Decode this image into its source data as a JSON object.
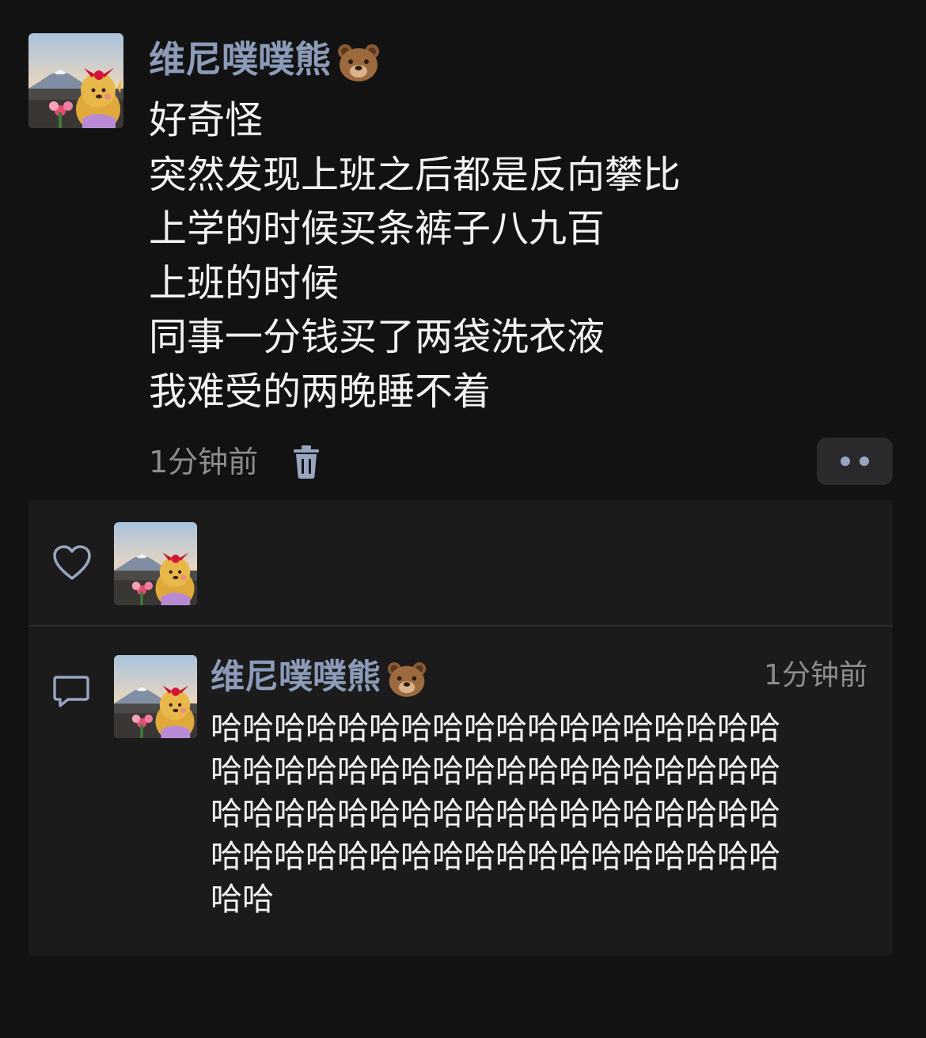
{
  "post": {
    "author": {
      "name": "维尼噗噗熊",
      "emoji": "bear-face-emoji",
      "avatar": "avatar-winnie-pooh-mount-fuji"
    },
    "lines": [
      "好奇怪",
      "突然发现上班之后都是反向攀比",
      "上学的时候买条裤子八九百",
      "上班的时候",
      "同事一分钱买了两袋洗衣液",
      "我难受的两晚睡不着"
    ],
    "time": "1分钟前",
    "delete_icon": "trash-icon",
    "more_icon": "more-dots-icon"
  },
  "likes": {
    "icon": "heart-icon",
    "avatars": [
      "avatar-winnie-pooh-mount-fuji"
    ]
  },
  "comments": {
    "icon": "comment-icon",
    "items": [
      {
        "author": "维尼噗噗熊",
        "emoji": "bear-face-emoji",
        "time": "1分钟前",
        "lines": [
          "哈哈哈哈哈哈哈哈哈哈哈哈哈哈哈哈哈哈",
          "哈哈哈哈哈哈哈哈哈哈哈哈哈哈哈哈哈哈",
          "哈哈哈哈哈哈哈哈哈哈哈哈哈哈哈哈哈哈",
          "哈哈哈哈哈哈哈哈哈哈哈哈哈哈哈哈哈哈",
          "哈哈"
        ]
      }
    ]
  },
  "colors": {
    "background": "#121212",
    "panel": "#1b1b1b",
    "name": "#8b9bb8",
    "text": "#f2f2f2",
    "muted": "#8d8d8d",
    "icon": "#97a5c1"
  }
}
